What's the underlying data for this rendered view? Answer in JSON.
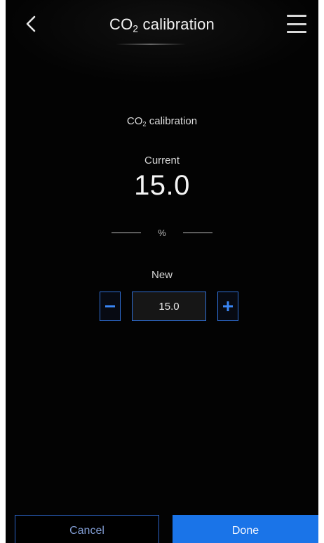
{
  "header": {
    "title_prefix": "CO",
    "title_sub": "2",
    "title_suffix": " calibration",
    "back_icon": "chevron-left-icon",
    "menu_icon": "hamburger-menu-icon"
  },
  "calibration": {
    "title_prefix": "CO",
    "title_sub": "2",
    "title_suffix": " calibration",
    "current_label": "Current",
    "current_value": "15.0",
    "unit": "%",
    "new_label": "New",
    "new_value": "15.0",
    "minus_icon": "minus-icon",
    "plus_icon": "plus-icon"
  },
  "footer": {
    "cancel_label": "Cancel",
    "done_label": "Done"
  },
  "colors": {
    "background": "#030303",
    "accent_blue": "#1a74e8",
    "stepper_border": "#2f6fd6"
  }
}
